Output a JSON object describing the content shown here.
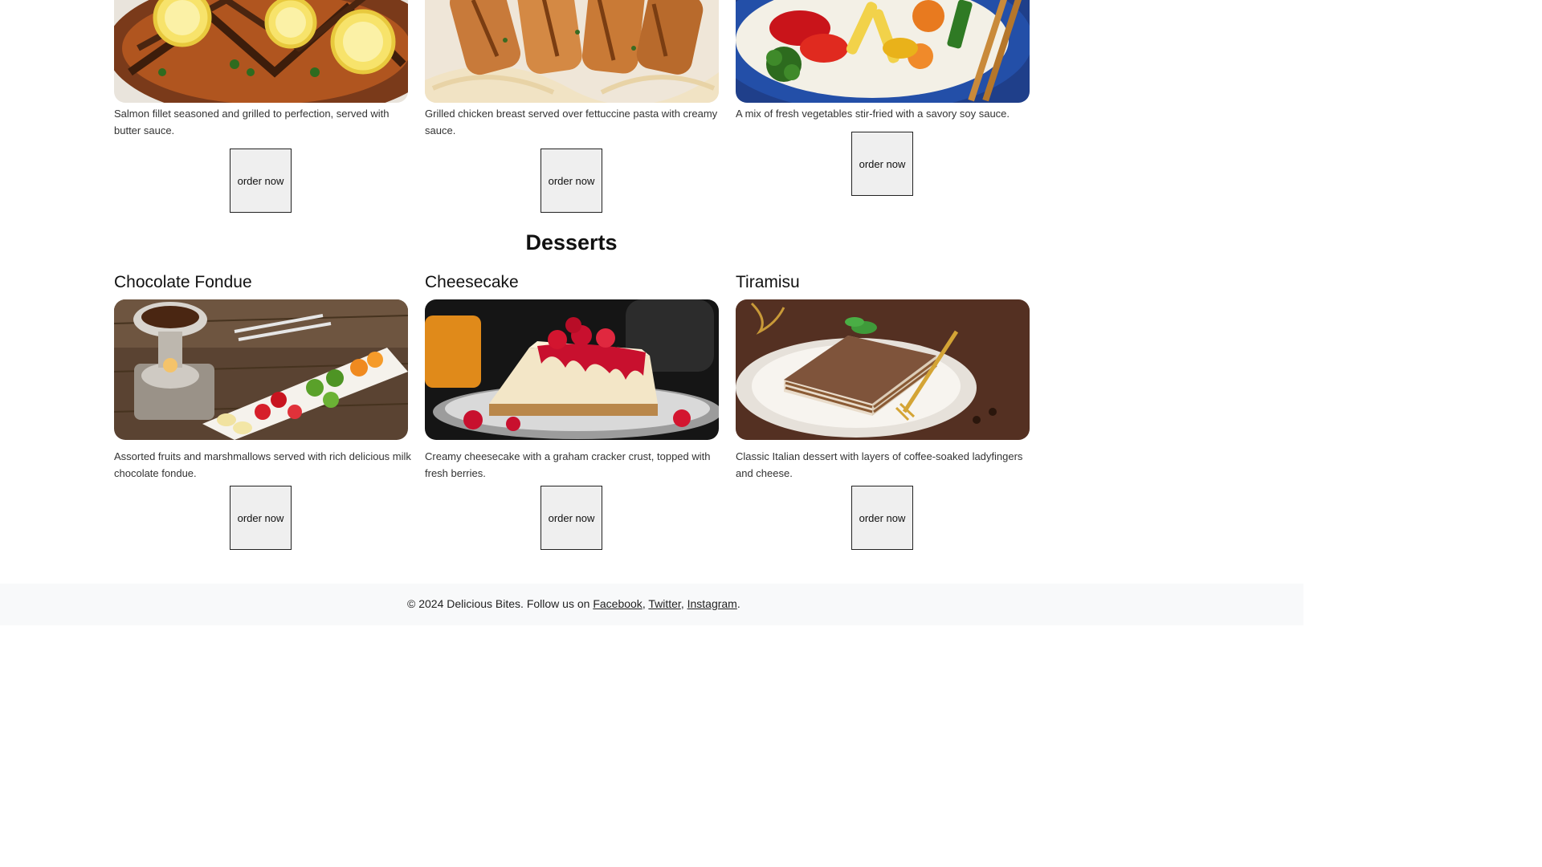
{
  "mains": [
    {
      "description": "Salmon fillet seasoned and grilled to perfection, served with butter sauce.",
      "image": "grilled-salmon-image",
      "order_label": "order now"
    },
    {
      "description": "Grilled chicken breast served over fettuccine pasta with creamy sauce.",
      "image": "chicken-fettuccine-image",
      "order_label": "order now"
    },
    {
      "description": "A mix of fresh vegetables stir-fried with a savory soy sauce.",
      "image": "vegetable-stir-fry-image",
      "order_label": "order now"
    }
  ],
  "desserts": {
    "heading": "Desserts",
    "items": [
      {
        "title": "Chocolate Fondue",
        "description": "Assorted fruits and marshmallows served with rich delicious milk chocolate fondue.",
        "image": "chocolate-fondue-image",
        "order_label": "order now"
      },
      {
        "title": "Cheesecake",
        "description": "Creamy cheesecake with a graham cracker crust, topped with fresh berries.",
        "image": "cheesecake-image",
        "order_label": "order now"
      },
      {
        "title": "Tiramisu",
        "description": "Classic Italian dessert with layers of coffee-soaked ladyfingers and cheese.",
        "image": "tiramisu-image",
        "order_label": "order now"
      }
    ]
  },
  "footer": {
    "text": "© 2024 Delicious Bites. Follow us on",
    "links": [
      "Facebook",
      "Twitter",
      "Instagram"
    ],
    "separator": ",",
    "end": "."
  },
  "colors": {
    "footer_bg": "#f8f9fa",
    "button_bg": "#efefef",
    "text": "#212529"
  }
}
